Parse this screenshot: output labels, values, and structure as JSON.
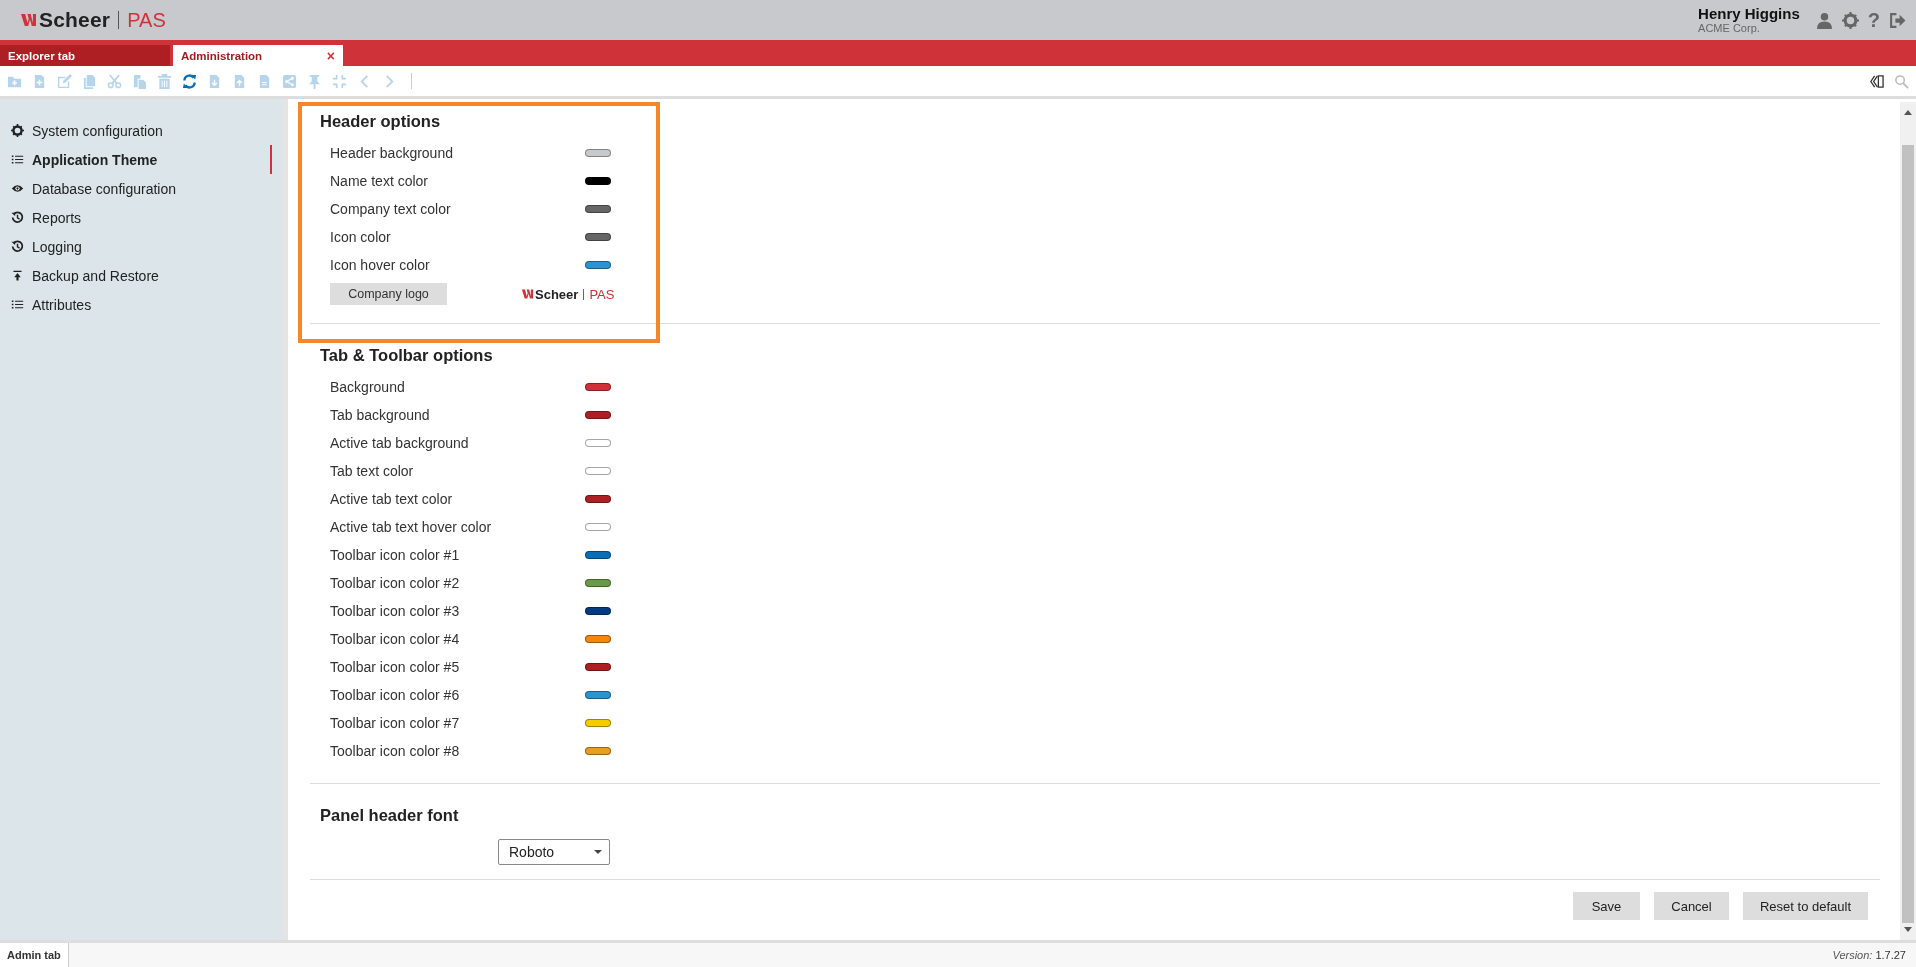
{
  "header": {
    "logo": {
      "name": "Scheer",
      "product": "PAS"
    },
    "user": {
      "name": "Henry Higgins",
      "company": "ACME Corp."
    },
    "icons": [
      {
        "kind": "user"
      },
      {
        "kind": "settings"
      },
      {
        "kind": "help",
        "text": "?"
      },
      {
        "kind": "logout"
      }
    ]
  },
  "tabs": [
    {
      "label": "Explorer tab",
      "selected": false
    },
    {
      "label": "Administration",
      "selected": true,
      "close": "×"
    }
  ],
  "toolbar": {
    "left": [
      {
        "kind": "folder-add",
        "disabled": true
      },
      {
        "kind": "file-add",
        "disabled": true
      },
      {
        "kind": "edit",
        "disabled": true
      },
      {
        "kind": "copy",
        "disabled": true
      },
      {
        "kind": "cut",
        "disabled": true
      },
      {
        "kind": "paste",
        "disabled": true
      },
      {
        "kind": "trash",
        "disabled": true
      },
      {
        "kind": "refresh",
        "disabled": false
      },
      {
        "kind": "download",
        "disabled": true
      },
      {
        "kind": "upload",
        "disabled": true
      },
      {
        "kind": "document",
        "disabled": true
      },
      {
        "kind": "share",
        "disabled": true
      },
      {
        "kind": "pin",
        "disabled": true
      },
      {
        "kind": "collapse",
        "disabled": true
      },
      {
        "kind": "prev",
        "disabled": true
      },
      {
        "kind": "next",
        "disabled": true
      }
    ],
    "right": [
      {
        "kind": "panel-toggle",
        "disabled": false
      },
      {
        "kind": "search",
        "disabled": true
      }
    ]
  },
  "sidebar": {
    "items": [
      {
        "kind": "gear",
        "label": "System configuration",
        "selected": false
      },
      {
        "kind": "list",
        "label": "Application Theme",
        "selected": true
      },
      {
        "kind": "eye",
        "label": "Database configuration",
        "selected": false
      },
      {
        "kind": "history",
        "label": "Reports",
        "selected": false
      },
      {
        "kind": "history",
        "label": "Logging",
        "selected": false
      },
      {
        "kind": "upload",
        "label": "Backup and Restore",
        "selected": false
      },
      {
        "kind": "list",
        "label": "Attributes",
        "selected": false
      }
    ]
  },
  "sections": [
    {
      "title": "Header options",
      "highlighted": true,
      "rows": [
        {
          "label": "Header background",
          "color": "#c8c9cc"
        },
        {
          "label": "Name text color",
          "color": "#000000"
        },
        {
          "label": "Company text color",
          "color": "#666666"
        },
        {
          "label": "Icon color",
          "color": "#666666"
        },
        {
          "label": "Icon hover color",
          "color": "#2a93d0"
        }
      ],
      "logo": {
        "button": "Company logo",
        "name": "Scheer",
        "product": "PAS"
      }
    },
    {
      "title": "Tab & Toolbar options",
      "rows": [
        {
          "label": "Background",
          "color": "#d0323a"
        },
        {
          "label": "Tab background",
          "color": "#ad1f22"
        },
        {
          "label": "Active tab background",
          "color": "#ffffff"
        },
        {
          "label": "Tab text color",
          "color": "#ffffff"
        },
        {
          "label": "Active tab text color",
          "color": "#ad1f22"
        },
        {
          "label": "Active tab text hover color",
          "color": "#ffffff"
        },
        {
          "label": "Toolbar icon color #1",
          "color": "#0a6eb4"
        },
        {
          "label": "Toolbar icon color #2",
          "color": "#6a9a46"
        },
        {
          "label": "Toolbar icon color #3",
          "color": "#053a80"
        },
        {
          "label": "Toolbar icon color #4",
          "color": "#f5860e"
        },
        {
          "label": "Toolbar icon color #5",
          "color": "#ad1f22"
        },
        {
          "label": "Toolbar icon color #6",
          "color": "#2a93d0"
        },
        {
          "label": "Toolbar icon color #7",
          "color": "#f5cc00"
        },
        {
          "label": "Toolbar icon color #8",
          "color": "#e89c24"
        }
      ]
    },
    {
      "title": "Panel header font",
      "select": {
        "value": "Roboto"
      }
    }
  ],
  "buttons": [
    "Save",
    "Cancel",
    "Reset to default"
  ],
  "status_bar": {
    "tab": "Admin tab",
    "version_label": "Version:",
    "version": "1.7.27"
  }
}
